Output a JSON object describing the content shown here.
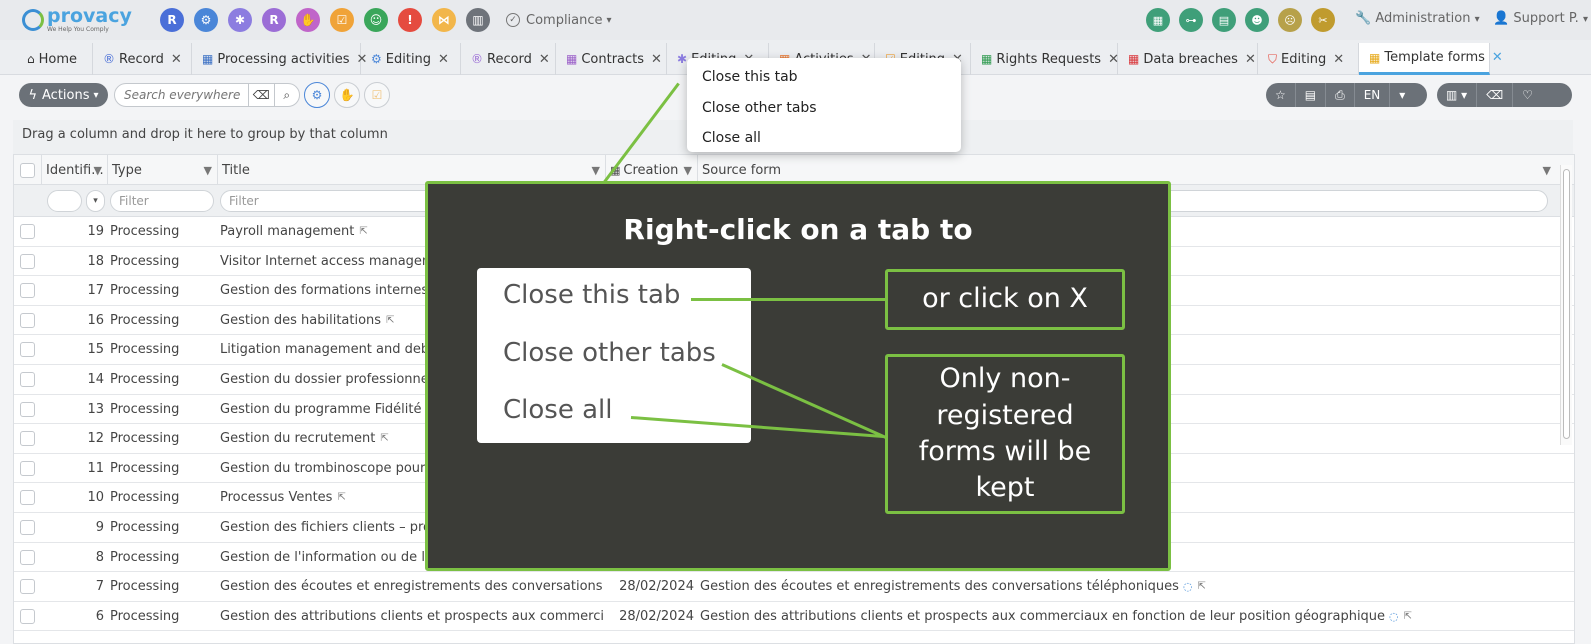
{
  "app": {
    "brand": "provacy",
    "tagline": "We Help You Comply",
    "modules": [
      {
        "icon": "r-icon",
        "glyph": "R",
        "color": "#4a6fd8"
      },
      {
        "icon": "flow-icon",
        "glyph": "⚙",
        "color": "#4a86d8"
      },
      {
        "icon": "network-icon",
        "glyph": "✱",
        "color": "#8c7de0"
      },
      {
        "icon": "r2-icon",
        "glyph": "R",
        "color": "#9b6dd6"
      },
      {
        "icon": "handshake-icon",
        "glyph": "✋",
        "color": "#c065c9"
      },
      {
        "icon": "checklist-icon",
        "glyph": "☑",
        "color": "#f0a338"
      },
      {
        "icon": "user-icon",
        "glyph": "☺",
        "color": "#3aa65a"
      },
      {
        "icon": "shield-icon",
        "glyph": "!",
        "color": "#e54b3f"
      },
      {
        "icon": "share-icon",
        "glyph": "⋈",
        "color": "#f2b64a"
      },
      {
        "icon": "library-icon",
        "glyph": "▥",
        "color": "#6e737a"
      }
    ],
    "compliance_label": "Compliance",
    "right_modules": [
      {
        "icon": "building-icon",
        "glyph": "▦",
        "color": "#3f9f79"
      },
      {
        "icon": "org-chart-icon",
        "glyph": "⊶",
        "color": "#3f9f79"
      },
      {
        "icon": "building-search-icon",
        "glyph": "▤",
        "color": "#3f9f79"
      },
      {
        "icon": "people-icon",
        "glyph": "☻",
        "color": "#3f9f79"
      },
      {
        "icon": "team-icon",
        "glyph": "☹",
        "color": "#b7a14a"
      },
      {
        "icon": "tools-icon",
        "glyph": "✂",
        "color": "#c09b2e"
      }
    ],
    "admin_label": "Administration",
    "support_label": "Support P."
  },
  "tabs": [
    {
      "label": "Home",
      "icon": "⌂",
      "color": "#333",
      "closable": false
    },
    {
      "label": "Record",
      "icon": "®",
      "color": "#4a6fd8",
      "closable": true
    },
    {
      "label": "Processing activities",
      "icon": "▦",
      "color": "#3a6fc4",
      "closable": true
    },
    {
      "label": "Editing",
      "icon": "⚙",
      "color": "#4a86d8",
      "closable": true
    },
    {
      "label": "Record",
      "icon": "®",
      "color": "#9b6dd6",
      "closable": true
    },
    {
      "label": "Contracts",
      "icon": "▦",
      "color": "#9b5fc9",
      "closable": true
    },
    {
      "label": "Editing",
      "icon": "✱",
      "color": "#8c7de0",
      "closable": true
    },
    {
      "label": "Activities",
      "icon": "▦",
      "color": "#e9742b",
      "closable": true
    },
    {
      "label": "Editing",
      "icon": "☑",
      "color": "#f0a338",
      "closable": true
    },
    {
      "label": "Rights Requests",
      "icon": "▦",
      "color": "#2e9a4f",
      "closable": true
    },
    {
      "label": "Data breaches",
      "icon": "▦",
      "color": "#d9363b",
      "closable": true
    },
    {
      "label": "Editing",
      "icon": "⛉",
      "color": "#e54b3f",
      "closable": true
    },
    {
      "label": "Template forms",
      "icon": "▦",
      "color": "#e6a817",
      "closable": true
    }
  ],
  "toolbar": {
    "actions_label": "Actions",
    "search_placeholder": "Search everywhere",
    "language": "EN"
  },
  "grid": {
    "group_hint": "Drag a column and drop it here to group by that column",
    "columns": [
      "Identifi...",
      "Type",
      "Title",
      "Creation",
      "Source form"
    ],
    "filter_placeholder": "Filter",
    "rows": [
      {
        "id": "19",
        "type": "Processing",
        "title": "Payroll management",
        "creation": "",
        "source": ""
      },
      {
        "id": "18",
        "type": "Processing",
        "title": "Visitor Internet access management",
        "creation": "",
        "source": ""
      },
      {
        "id": "17",
        "type": "Processing",
        "title": "Gestion des formations internes",
        "creation": "",
        "source": ""
      },
      {
        "id": "16",
        "type": "Processing",
        "title": "Gestion des habilitations",
        "creation": "",
        "source": ""
      },
      {
        "id": "15",
        "type": "Processing",
        "title": "Litigation management and debt co",
        "creation": "",
        "source": ""
      },
      {
        "id": "14",
        "type": "Processing",
        "title": "Gestion du dossier professionnel des",
        "creation": "",
        "source": ""
      },
      {
        "id": "13",
        "type": "Processing",
        "title": "Gestion du programme Fidélité",
        "creation": "",
        "source": ""
      },
      {
        "id": "12",
        "type": "Processing",
        "title": "Gestion du recrutement",
        "creation": "",
        "source": ""
      },
      {
        "id": "11",
        "type": "Processing",
        "title": "Gestion du trombinoscope pour l'intr",
        "creation": "",
        "source": ""
      },
      {
        "id": "10",
        "type": "Processing",
        "title": "Processus Ventes",
        "creation": "",
        "source": ""
      },
      {
        "id": "9",
        "type": "Processing",
        "title": "Gestion des fichiers clients – prospec",
        "creation": "",
        "source": ""
      },
      {
        "id": "8",
        "type": "Processing",
        "title": "Gestion de l'information ou de la con",
        "creation": "",
        "source": ""
      },
      {
        "id": "7",
        "type": "Processing",
        "title": "Gestion des écoutes et enregistrements des conversations télépho...",
        "creation": "28/02/2024",
        "source": "Gestion des écoutes et enregistrements des conversations téléphoniques"
      },
      {
        "id": "6",
        "type": "Processing",
        "title": "Gestion des attributions clients et prospects aux commerciaux en f...",
        "creation": "28/02/2024",
        "source": "Gestion des attributions clients et prospects aux commerciaux en fonction de leur position géographique"
      }
    ]
  },
  "context_menu": {
    "items": [
      "Close this tab",
      "Close other tabs",
      "Close all"
    ]
  },
  "callout": {
    "title": "Right-click on a tab to",
    "menu_items": [
      "Close this tab",
      "Close other tabs",
      "Close all"
    ],
    "note_x": "or click on X",
    "note_kept": "Only non-registered forms will be kept"
  }
}
